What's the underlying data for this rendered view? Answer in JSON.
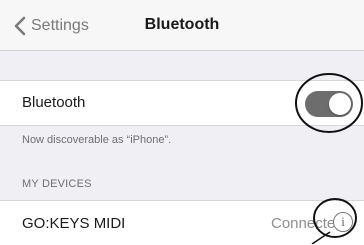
{
  "nav": {
    "back_label": "Settings",
    "title": "Bluetooth",
    "back_icon": "chevron-left-icon"
  },
  "bluetooth_row": {
    "label": "Bluetooth",
    "toggle_on": true
  },
  "discoverable_note": "Now discoverable as “iPhone”.",
  "devices_section": {
    "header": "MY DEVICES",
    "items": [
      {
        "name": "GO:KEYS MIDI",
        "status": "Connected",
        "info_icon": "info-icon"
      }
    ]
  },
  "colors": {
    "background": "#efeff4",
    "toggle_track": "#6d6d6d",
    "annotation": "#111111"
  }
}
